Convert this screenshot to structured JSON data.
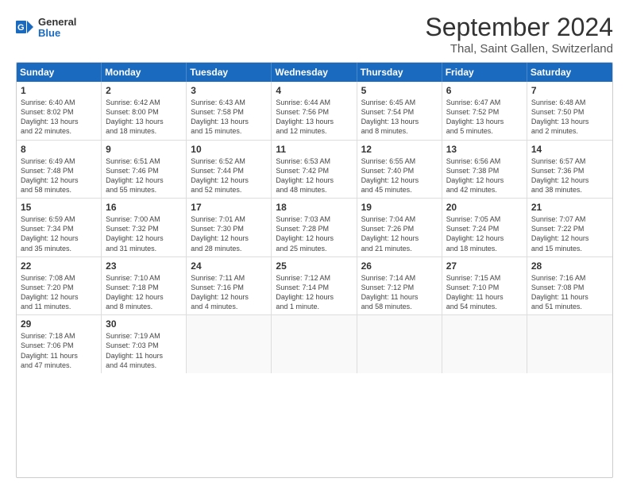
{
  "header": {
    "logo_line1": "General",
    "logo_line2": "Blue",
    "title": "September 2024",
    "subtitle": "Thal, Saint Gallen, Switzerland"
  },
  "weekdays": [
    "Sunday",
    "Monday",
    "Tuesday",
    "Wednesday",
    "Thursday",
    "Friday",
    "Saturday"
  ],
  "weeks": [
    [
      {
        "day": "1",
        "lines": [
          "Sunrise: 6:40 AM",
          "Sunset: 8:02 PM",
          "Daylight: 13 hours",
          "and 22 minutes."
        ]
      },
      {
        "day": "2",
        "lines": [
          "Sunrise: 6:42 AM",
          "Sunset: 8:00 PM",
          "Daylight: 13 hours",
          "and 18 minutes."
        ]
      },
      {
        "day": "3",
        "lines": [
          "Sunrise: 6:43 AM",
          "Sunset: 7:58 PM",
          "Daylight: 13 hours",
          "and 15 minutes."
        ]
      },
      {
        "day": "4",
        "lines": [
          "Sunrise: 6:44 AM",
          "Sunset: 7:56 PM",
          "Daylight: 13 hours",
          "and 12 minutes."
        ]
      },
      {
        "day": "5",
        "lines": [
          "Sunrise: 6:45 AM",
          "Sunset: 7:54 PM",
          "Daylight: 13 hours",
          "and 8 minutes."
        ]
      },
      {
        "day": "6",
        "lines": [
          "Sunrise: 6:47 AM",
          "Sunset: 7:52 PM",
          "Daylight: 13 hours",
          "and 5 minutes."
        ]
      },
      {
        "day": "7",
        "lines": [
          "Sunrise: 6:48 AM",
          "Sunset: 7:50 PM",
          "Daylight: 13 hours",
          "and 2 minutes."
        ]
      }
    ],
    [
      {
        "day": "8",
        "lines": [
          "Sunrise: 6:49 AM",
          "Sunset: 7:48 PM",
          "Daylight: 12 hours",
          "and 58 minutes."
        ]
      },
      {
        "day": "9",
        "lines": [
          "Sunrise: 6:51 AM",
          "Sunset: 7:46 PM",
          "Daylight: 12 hours",
          "and 55 minutes."
        ]
      },
      {
        "day": "10",
        "lines": [
          "Sunrise: 6:52 AM",
          "Sunset: 7:44 PM",
          "Daylight: 12 hours",
          "and 52 minutes."
        ]
      },
      {
        "day": "11",
        "lines": [
          "Sunrise: 6:53 AM",
          "Sunset: 7:42 PM",
          "Daylight: 12 hours",
          "and 48 minutes."
        ]
      },
      {
        "day": "12",
        "lines": [
          "Sunrise: 6:55 AM",
          "Sunset: 7:40 PM",
          "Daylight: 12 hours",
          "and 45 minutes."
        ]
      },
      {
        "day": "13",
        "lines": [
          "Sunrise: 6:56 AM",
          "Sunset: 7:38 PM",
          "Daylight: 12 hours",
          "and 42 minutes."
        ]
      },
      {
        "day": "14",
        "lines": [
          "Sunrise: 6:57 AM",
          "Sunset: 7:36 PM",
          "Daylight: 12 hours",
          "and 38 minutes."
        ]
      }
    ],
    [
      {
        "day": "15",
        "lines": [
          "Sunrise: 6:59 AM",
          "Sunset: 7:34 PM",
          "Daylight: 12 hours",
          "and 35 minutes."
        ]
      },
      {
        "day": "16",
        "lines": [
          "Sunrise: 7:00 AM",
          "Sunset: 7:32 PM",
          "Daylight: 12 hours",
          "and 31 minutes."
        ]
      },
      {
        "day": "17",
        "lines": [
          "Sunrise: 7:01 AM",
          "Sunset: 7:30 PM",
          "Daylight: 12 hours",
          "and 28 minutes."
        ]
      },
      {
        "day": "18",
        "lines": [
          "Sunrise: 7:03 AM",
          "Sunset: 7:28 PM",
          "Daylight: 12 hours",
          "and 25 minutes."
        ]
      },
      {
        "day": "19",
        "lines": [
          "Sunrise: 7:04 AM",
          "Sunset: 7:26 PM",
          "Daylight: 12 hours",
          "and 21 minutes."
        ]
      },
      {
        "day": "20",
        "lines": [
          "Sunrise: 7:05 AM",
          "Sunset: 7:24 PM",
          "Daylight: 12 hours",
          "and 18 minutes."
        ]
      },
      {
        "day": "21",
        "lines": [
          "Sunrise: 7:07 AM",
          "Sunset: 7:22 PM",
          "Daylight: 12 hours",
          "and 15 minutes."
        ]
      }
    ],
    [
      {
        "day": "22",
        "lines": [
          "Sunrise: 7:08 AM",
          "Sunset: 7:20 PM",
          "Daylight: 12 hours",
          "and 11 minutes."
        ]
      },
      {
        "day": "23",
        "lines": [
          "Sunrise: 7:10 AM",
          "Sunset: 7:18 PM",
          "Daylight: 12 hours",
          "and 8 minutes."
        ]
      },
      {
        "day": "24",
        "lines": [
          "Sunrise: 7:11 AM",
          "Sunset: 7:16 PM",
          "Daylight: 12 hours",
          "and 4 minutes."
        ]
      },
      {
        "day": "25",
        "lines": [
          "Sunrise: 7:12 AM",
          "Sunset: 7:14 PM",
          "Daylight: 12 hours",
          "and 1 minute."
        ]
      },
      {
        "day": "26",
        "lines": [
          "Sunrise: 7:14 AM",
          "Sunset: 7:12 PM",
          "Daylight: 11 hours",
          "and 58 minutes."
        ]
      },
      {
        "day": "27",
        "lines": [
          "Sunrise: 7:15 AM",
          "Sunset: 7:10 PM",
          "Daylight: 11 hours",
          "and 54 minutes."
        ]
      },
      {
        "day": "28",
        "lines": [
          "Sunrise: 7:16 AM",
          "Sunset: 7:08 PM",
          "Daylight: 11 hours",
          "and 51 minutes."
        ]
      }
    ],
    [
      {
        "day": "29",
        "lines": [
          "Sunrise: 7:18 AM",
          "Sunset: 7:06 PM",
          "Daylight: 11 hours",
          "and 47 minutes."
        ]
      },
      {
        "day": "30",
        "lines": [
          "Sunrise: 7:19 AM",
          "Sunset: 7:03 PM",
          "Daylight: 11 hours",
          "and 44 minutes."
        ]
      },
      {
        "day": "",
        "lines": []
      },
      {
        "day": "",
        "lines": []
      },
      {
        "day": "",
        "lines": []
      },
      {
        "day": "",
        "lines": []
      },
      {
        "day": "",
        "lines": []
      }
    ]
  ]
}
